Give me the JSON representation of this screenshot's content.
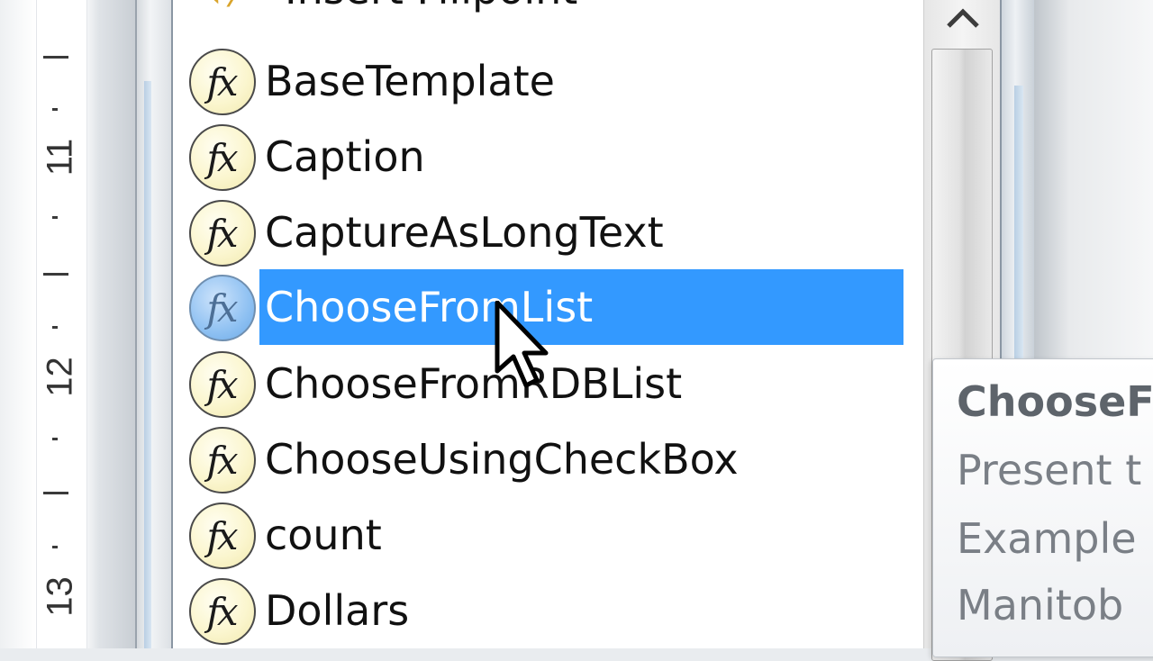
{
  "ruler": {
    "numbers": [
      "11",
      "12",
      "13"
    ]
  },
  "list": {
    "partial_top_item": "Insert Fillpoint",
    "icon": "fx-function-icon",
    "icon_text": "fx",
    "items": [
      {
        "label": "BaseTemplate",
        "selected": false
      },
      {
        "label": "Caption",
        "selected": false
      },
      {
        "label": "CaptureAsLongText",
        "selected": false
      },
      {
        "label": "ChooseFromList",
        "selected": true
      },
      {
        "label": "ChooseFromRDBList",
        "selected": false
      },
      {
        "label": "ChooseUsingCheckBox",
        "selected": false
      },
      {
        "label": "count",
        "selected": false
      },
      {
        "label": "Dollars",
        "selected": false
      }
    ]
  },
  "tooltip": {
    "title": "ChooseF",
    "line1": "Present t",
    "line2": "Example",
    "line3": "Manitob"
  },
  "colors": {
    "selection": "#3399ff",
    "icon_fill": "#fbf6cf"
  }
}
